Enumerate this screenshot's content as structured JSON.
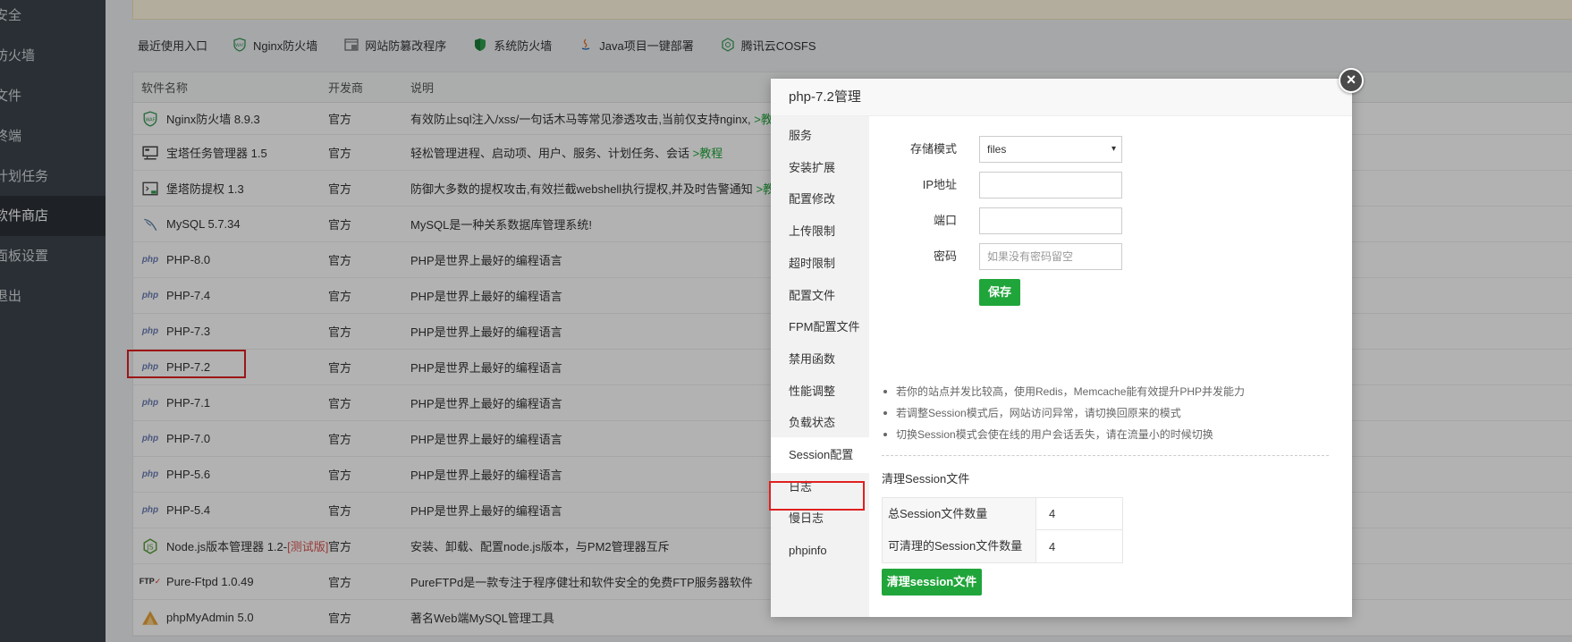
{
  "sidebar": {
    "items": [
      {
        "label": "安全"
      },
      {
        "label": "防火墙"
      },
      {
        "label": "文件"
      },
      {
        "label": "终端"
      },
      {
        "label": "计划任务"
      },
      {
        "label": "软件商店"
      },
      {
        "label": "面板设置"
      },
      {
        "label": "退出"
      }
    ]
  },
  "recent": {
    "label": "最近使用入口",
    "items": [
      {
        "label": "Nginx防火墙",
        "icon": "waf-icon"
      },
      {
        "label": "网站防篡改程序",
        "icon": "tamper-icon"
      },
      {
        "label": "系统防火墙",
        "icon": "shield-icon"
      },
      {
        "label": "Java项目一键部署",
        "icon": "java-icon"
      },
      {
        "label": "腾讯云COSFS",
        "icon": "cos-icon"
      }
    ]
  },
  "table": {
    "headers": [
      "软件名称",
      "开发商",
      "说明"
    ],
    "rows": [
      {
        "name": "Nginx防火墙 8.9.3",
        "vendor": "官方",
        "desc": "有效防止sql注入/xss/一句话木马等常见渗透攻击,当前仅支持nginx,",
        "link": ">教程",
        "icon": "waf"
      },
      {
        "name": "宝塔任务管理器 1.5",
        "vendor": "官方",
        "desc": "轻松管理进程、启动项、用户、服务、计划任务、会话",
        "link": ">教程",
        "icon": "task"
      },
      {
        "name": "堡塔防提权 1.3",
        "vendor": "官方",
        "desc": "防御大多数的提权攻击,有效拦截webshell执行提权,并及时告警通知",
        "link": ">教程",
        "icon": "term"
      },
      {
        "name": "MySQL 5.7.34",
        "vendor": "官方",
        "desc": "MySQL是一种关系数据库管理系统!",
        "link": "",
        "icon": "mysql"
      },
      {
        "name": "PHP-8.0",
        "vendor": "官方",
        "desc": "PHP是世界上最好的编程语言",
        "link": "",
        "icon": "php"
      },
      {
        "name": "PHP-7.4",
        "vendor": "官方",
        "desc": "PHP是世界上最好的编程语言",
        "link": "",
        "icon": "php"
      },
      {
        "name": "PHP-7.3",
        "vendor": "官方",
        "desc": "PHP是世界上最好的编程语言",
        "link": "",
        "icon": "php"
      },
      {
        "name": "PHP-7.2",
        "vendor": "官方",
        "desc": "PHP是世界上最好的编程语言",
        "link": "",
        "icon": "php"
      },
      {
        "name": "PHP-7.1",
        "vendor": "官方",
        "desc": "PHP是世界上最好的编程语言",
        "link": "",
        "icon": "php"
      },
      {
        "name": "PHP-7.0",
        "vendor": "官方",
        "desc": "PHP是世界上最好的编程语言",
        "link": "",
        "icon": "php"
      },
      {
        "name": "PHP-5.6",
        "vendor": "官方",
        "desc": "PHP是世界上最好的编程语言",
        "link": "",
        "icon": "php"
      },
      {
        "name": "PHP-5.4",
        "vendor": "官方",
        "desc": "PHP是世界上最好的编程语言",
        "link": "",
        "icon": "php"
      },
      {
        "name": "Node.js版本管理器 1.2-",
        "tag": "[测试版]",
        "vendor": "官方",
        "desc": "安装、卸载、配置node.js版本，与PM2管理器互斥",
        "link": "",
        "icon": "node"
      },
      {
        "name": "Pure-Ftpd 1.0.49",
        "vendor": "官方",
        "desc": "PureFTPd是一款专注于程序健壮和软件安全的免费FTP服务器软件",
        "link": "",
        "icon": "ftp"
      },
      {
        "name": "phpMyAdmin 5.0",
        "vendor": "官方",
        "desc": "著名Web端MySQL管理工具",
        "link": "",
        "icon": "pma"
      }
    ]
  },
  "modal": {
    "title": "php-7.2管理",
    "close": "×",
    "tabs": [
      "服务",
      "安装扩展",
      "配置修改",
      "上传限制",
      "超时限制",
      "配置文件",
      "FPM配置文件",
      "禁用函数",
      "性能调整",
      "负载状态",
      "Session配置",
      "日志",
      "慢日志",
      "phpinfo"
    ],
    "active_tab": "Session配置",
    "form": {
      "storage_label": "存储模式",
      "storage_value": "files",
      "ip_label": "IP地址",
      "ip_value": "",
      "port_label": "端口",
      "port_value": "",
      "password_label": "密码",
      "password_placeholder": "如果没有密码留空",
      "save_label": "保存"
    },
    "tips": [
      "若你的站点并发比较高，使用Redis，Memcache能有效提升PHP并发能力",
      "若调整Session模式后，网站访问异常，请切换回原来的模式",
      "切换Session模式会使在线的用户会话丢失，请在流量小的时候切换"
    ],
    "clean_title": "清理Session文件",
    "stats": [
      {
        "label": "总Session文件数量",
        "value": "4"
      },
      {
        "label": "可清理的Session文件数量",
        "value": "4"
      }
    ],
    "clean_button": "清理session文件"
  }
}
